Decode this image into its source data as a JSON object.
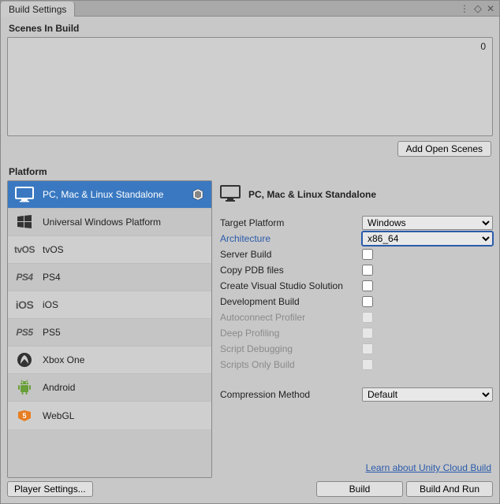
{
  "window": {
    "title": "Build Settings"
  },
  "scenes": {
    "label": "Scenes In Build",
    "count": "0",
    "add_button": "Add Open Scenes"
  },
  "platform_label": "Platform",
  "platforms": [
    {
      "name": "PC, Mac & Linux Standalone"
    },
    {
      "name": "Universal Windows Platform"
    },
    {
      "name": "tvOS"
    },
    {
      "name": "PS4"
    },
    {
      "name": "iOS"
    },
    {
      "name": "PS5"
    },
    {
      "name": "Xbox One"
    },
    {
      "name": "Android"
    },
    {
      "name": "WebGL"
    }
  ],
  "detail": {
    "title": "PC, Mac & Linux Standalone",
    "target_platform": {
      "label": "Target Platform",
      "value": "Windows"
    },
    "architecture": {
      "label": "Architecture",
      "value": "x86_64"
    },
    "server_build": {
      "label": "Server Build"
    },
    "copy_pdb": {
      "label": "Copy PDB files"
    },
    "create_vs": {
      "label": "Create Visual Studio Solution"
    },
    "dev_build": {
      "label": "Development Build"
    },
    "autoconnect": {
      "label": "Autoconnect Profiler"
    },
    "deep_profiling": {
      "label": "Deep Profiling"
    },
    "script_debug": {
      "label": "Script Debugging"
    },
    "scripts_only": {
      "label": "Scripts Only Build"
    },
    "compression": {
      "label": "Compression Method",
      "value": "Default"
    },
    "cloud_link": "Learn about Unity Cloud Build"
  },
  "footer": {
    "player_settings": "Player Settings...",
    "build": "Build",
    "build_run": "Build And Run"
  }
}
